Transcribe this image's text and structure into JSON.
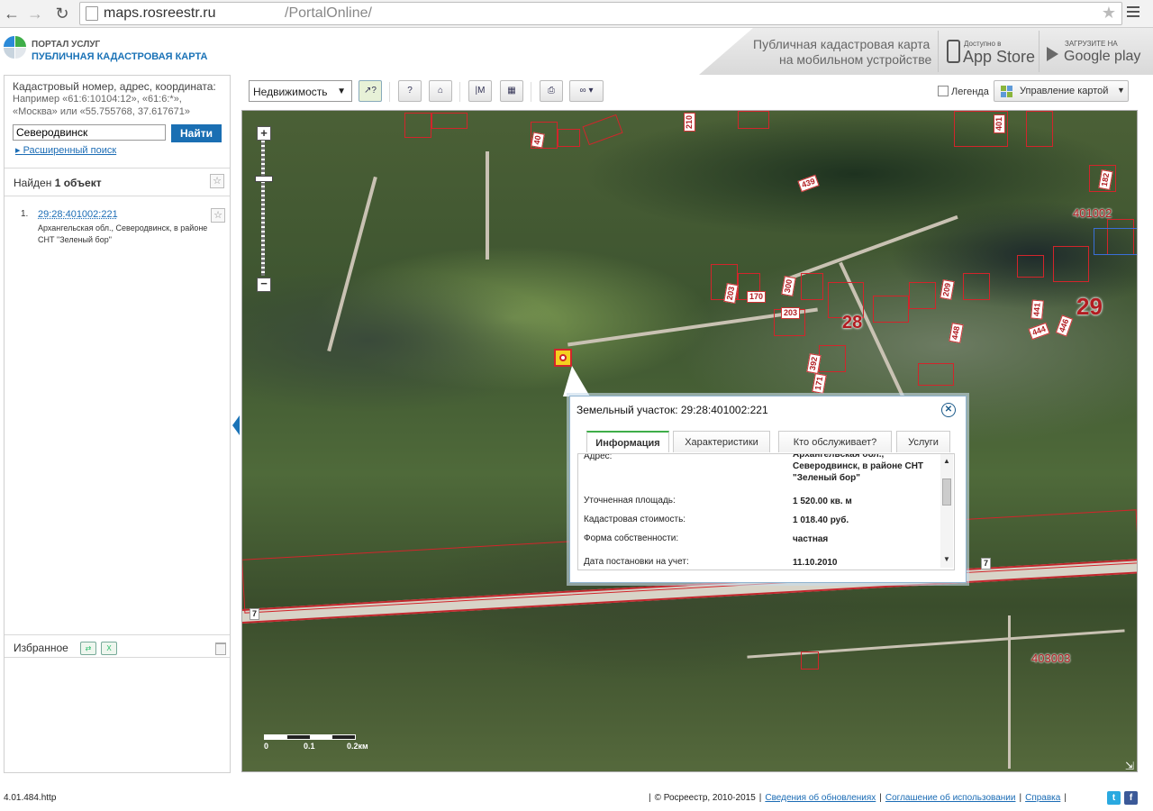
{
  "browser": {
    "url_host": "maps.rosreestr.ru",
    "url_path": "/PortalOnline/"
  },
  "header": {
    "portal_line1": "ПОРТАЛ УСЛУГ",
    "portal_line2": "ПУБЛИЧНАЯ КАДАСТРОВАЯ КАРТА",
    "mobile_line1": "Публичная кадастровая карта",
    "mobile_line2": "на мобильном устройстве",
    "appstore_small": "Доступно в",
    "appstore_big": "App Store",
    "googleplay_small": "ЗАГРУЗИТЕ НА",
    "googleplay_big": "Google play"
  },
  "search": {
    "hint1": "Кадастровый номер, адрес, координата:",
    "hint2": "Например «61:6:10104:12», «61:6:*»,",
    "hint3": "«Москва» или «55.755768, 37.617671»",
    "value": "Северодвинск",
    "button": "Найти",
    "advanced": "Расширенный поиск"
  },
  "results": {
    "found_prefix": "Найден ",
    "found_count": "1 объект",
    "items": [
      {
        "index": "1.",
        "cadastral": "29:28:401002:221",
        "address": "Архангельская обл., Северодвинск, в районе СНТ \"Зеленый бор\""
      }
    ]
  },
  "favorites": {
    "label": "Избранное"
  },
  "toolbar": {
    "layer_select": "Недвижимость",
    "legend_label": "Легенда",
    "map_manage": "Управление картой"
  },
  "map": {
    "zoom_plus": "+",
    "zoom_minus": "−",
    "quarters": [
      "401002",
      "403003"
    ],
    "districts": [
      "28",
      "29"
    ],
    "road_labels": [
      "7",
      "7"
    ],
    "parcel_labels": [
      "210",
      "40",
      "439",
      "203",
      "401",
      "170",
      "300",
      "392",
      "203",
      "446",
      "441",
      "444",
      "448",
      "209",
      "182",
      "171"
    ],
    "scale_labels": [
      "0",
      "0.1",
      "0.2км"
    ]
  },
  "popup": {
    "title": "Земельный участок: 29:28:401002:221",
    "tabs": [
      "Информация",
      "Характеристики",
      "Кто обслуживает?",
      "Услуги"
    ],
    "active_tab": "Информация",
    "fields": [
      {
        "label": "Адрес:",
        "value": "Архангельская обл., Северодвинск, в районе СНТ \"Зеленый бор\""
      },
      {
        "label": "Уточненная площадь:",
        "value": "1 520.00 кв. м"
      },
      {
        "label": "Кадастровая стоимость:",
        "value": "1 018.40 руб."
      },
      {
        "label": "Форма собственности:",
        "value": "частная"
      },
      {
        "label": "Дата постановки на учет:",
        "value": "11.10.2010"
      }
    ]
  },
  "footer": {
    "version": "4.01.484.http",
    "copyright": "© Росреестр, 2010-2015",
    "links": [
      "Сведения об обновлениях",
      "Соглашение об использовании",
      "Справка"
    ]
  }
}
